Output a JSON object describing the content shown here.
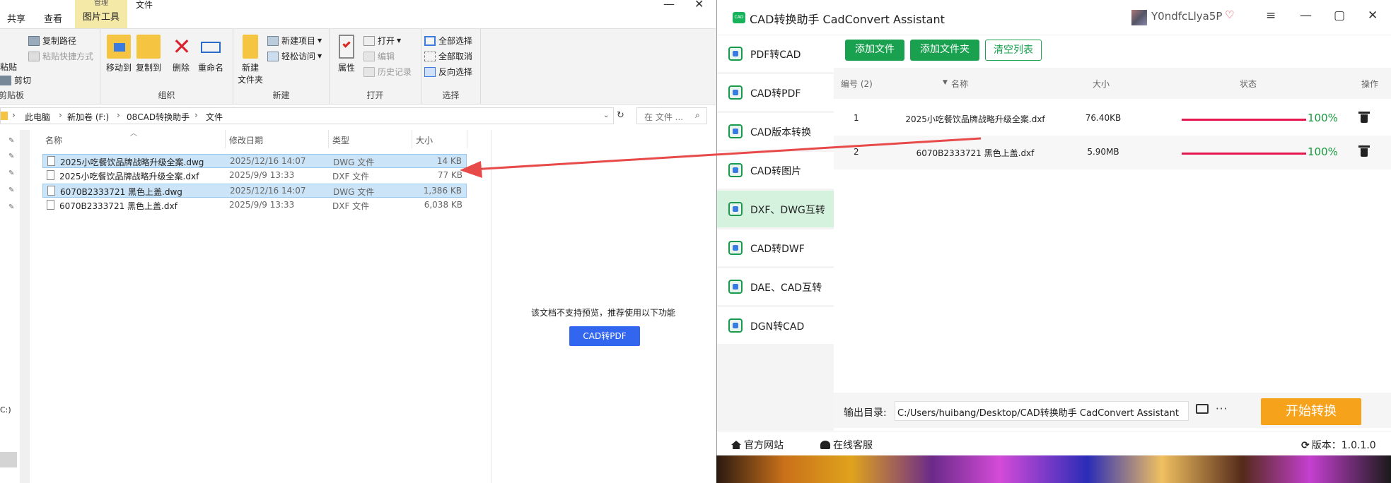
{
  "explorer": {
    "tabs": {
      "share": "共享",
      "view": "查看",
      "ctx_header": "管理",
      "ctx_tab": "图片工具",
      "right": "文件"
    },
    "window": {
      "min": "—",
      "close": "✕"
    },
    "ribbon": {
      "clipboard": {
        "paste": "粘贴",
        "copy_path": "复制路径",
        "paste_shortcut": "粘贴快捷方式",
        "cut": "剪切",
        "label": "剪贴板"
      },
      "organize": {
        "move_to": "移动到",
        "copy_to": "复制到",
        "delete": "删除",
        "rename": "重命名",
        "label": "组织"
      },
      "new": {
        "new_folder": "新建",
        "new_folder2": "文件夹",
        "new_item": "新建项目",
        "easy_access": "轻松访问",
        "label": "新建"
      },
      "open": {
        "properties": "属性",
        "open": "打开",
        "edit": "编辑",
        "history": "历史记录",
        "label": "打开"
      },
      "select": {
        "select_all": "全部选择",
        "select_none": "全部取消",
        "invert": "反向选择",
        "label": "选择"
      }
    },
    "address": {
      "crumbs": [
        "此电脑",
        "新加卷 (F:)",
        "08CAD转换助手",
        "文件"
      ],
      "search_placeholder": "在 文件 ..."
    },
    "columns": {
      "name": "名称",
      "date": "修改日期",
      "type": "类型",
      "size": "大小"
    },
    "files": [
      {
        "name": "2025小吃餐饮品牌战略升级全案.dwg",
        "date": "2025/12/16 14:07",
        "type": "DWG 文件",
        "size": "14 KB",
        "selected": true
      },
      {
        "name": "2025小吃餐饮品牌战略升级全案.dxf",
        "date": "2025/9/9 13:33",
        "type": "DXF 文件",
        "size": "77 KB",
        "selected": false
      },
      {
        "name": "6070B2333721 黑色上盖.dwg",
        "date": "2025/12/16 14:07",
        "type": "DWG 文件",
        "size": "1,386 KB",
        "selected": true
      },
      {
        "name": "6070B2333721 黑色上盖.dxf",
        "date": "2025/9/9 13:33",
        "type": "DXF 文件",
        "size": "6,038 KB",
        "selected": false
      }
    ],
    "nav_drive": "C:)",
    "preview": {
      "message": "该文档不支持预览，推荐使用以下功能",
      "button": "CAD转PDF"
    }
  },
  "cad": {
    "title": "CAD转换助手 CadConvert Assistant",
    "logo_text": "CAD",
    "user": "Y0ndfcLlya5P",
    "vip_icon": "diamond-icon",
    "sidebar": [
      {
        "label": "PDF转CAD",
        "active": false
      },
      {
        "label": "CAD转PDF",
        "active": false
      },
      {
        "label": "CAD版本转换",
        "active": false
      },
      {
        "label": "CAD转图片",
        "active": false
      },
      {
        "label": "DXF、DWG互转",
        "active": true
      },
      {
        "label": "CAD转DWF",
        "active": false
      },
      {
        "label": "DAE、CAD互转",
        "active": false
      },
      {
        "label": "DGN转CAD",
        "active": false
      }
    ],
    "toolbar": {
      "add_file": "添加文件",
      "add_folder": "添加文件夹",
      "clear_list": "清空列表"
    },
    "table": {
      "headers": {
        "index": "编号 (2)",
        "name": "名称",
        "size": "大小",
        "status": "状态",
        "action": "操作"
      },
      "rows": [
        {
          "index": "1",
          "name": "2025小吃餐饮品牌战略升级全案.dxf",
          "size": "76.40KB",
          "progress": 1.0,
          "percent": "100%"
        },
        {
          "index": "2",
          "name": "6070B2333721 黑色上盖.dxf",
          "size": "5.90MB",
          "progress": 1.0,
          "percent": "100%"
        }
      ]
    },
    "output": {
      "label": "输出目录:",
      "path": "C:/Users/huibang/Desktop/CAD转换助手 CadConvert Assistant",
      "more": "···"
    },
    "start": "开始转换",
    "footer": {
      "website": "官方网站",
      "service": "在线客服",
      "version": "版本：1.0.1.0"
    }
  },
  "colors": {
    "green": "#1aa14f",
    "orange": "#f7a21b",
    "progress": "#e5174f",
    "percent": "#1a9a3e",
    "arrow": "#e84a4a",
    "select_blue": "#cce4f7",
    "pdf_button": "#3366ee"
  }
}
